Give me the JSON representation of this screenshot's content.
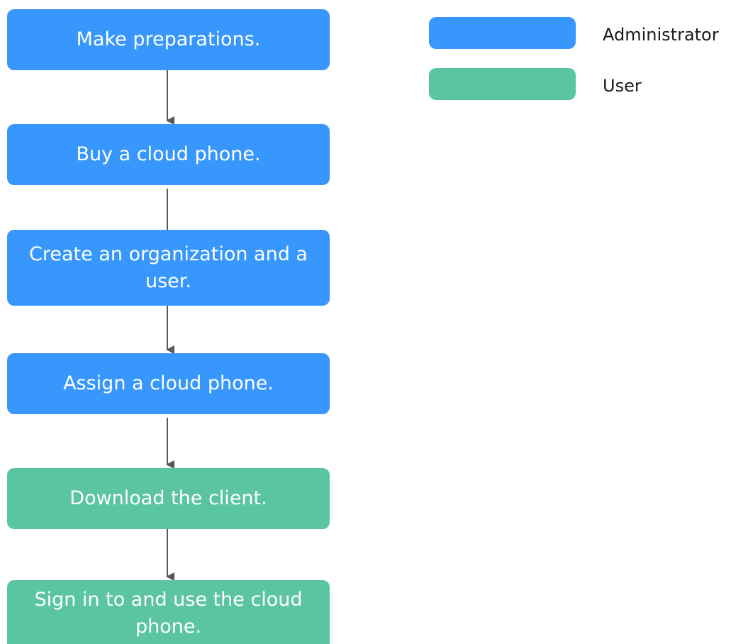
{
  "steps": [
    {
      "label": "Make preparations.",
      "role": "administrator"
    },
    {
      "label": "Buy a cloud phone.",
      "role": "administrator"
    },
    {
      "label": "Create an organization and a user.",
      "role": "administrator"
    },
    {
      "label": "Assign a cloud phone.",
      "role": "administrator"
    },
    {
      "label": "Download the client.",
      "role": "user"
    },
    {
      "label": "Sign in to and use the cloud phone.",
      "role": "user"
    }
  ],
  "legend": {
    "administrator": {
      "label": "Administrator",
      "color": "#3897fd"
    },
    "user": {
      "label": "User",
      "color": "#5bc5a0"
    }
  },
  "colors": {
    "connector": "#595959"
  }
}
